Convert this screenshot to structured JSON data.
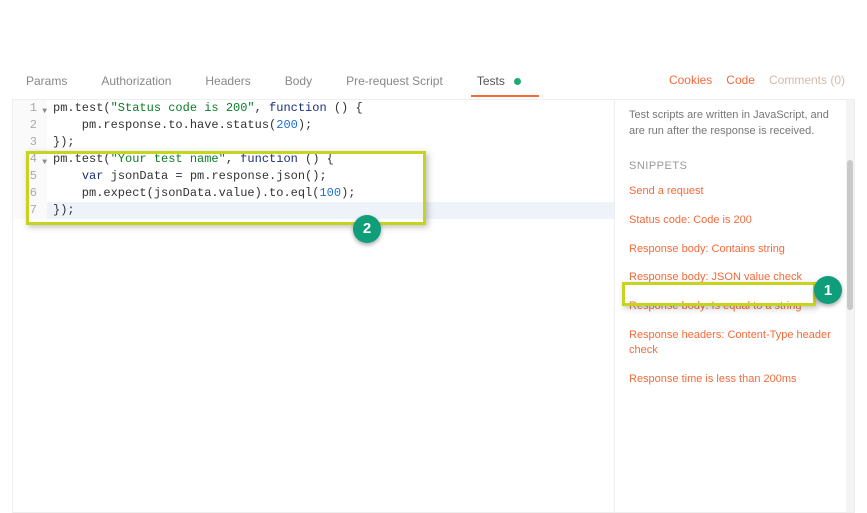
{
  "tabs": {
    "items": [
      "Params",
      "Authorization",
      "Headers",
      "Body",
      "Pre-request Script",
      "Tests"
    ],
    "active_index": 5
  },
  "links": {
    "cookies": "Cookies",
    "code": "Code",
    "comments": "Comments (0)"
  },
  "code": {
    "lines": [
      {
        "n": "1",
        "fold": "▼",
        "plain": "pm.test(",
        "str": "\"Status code is 200\"",
        "mid": ", ",
        "kw": "function",
        "tail": " () {"
      },
      {
        "n": "2",
        "plain": "    pm.response.to.have.status(",
        "num": "200",
        "tail": ");"
      },
      {
        "n": "3",
        "plain": "});"
      },
      {
        "n": "4",
        "fold": "▼",
        "plain": "pm.test(",
        "str": "\"Your test name\"",
        "mid": ", ",
        "kw": "function",
        "tail": " () {"
      },
      {
        "n": "5",
        "pre": "    ",
        "kw": "var",
        "plain": " jsonData = pm.response.json();"
      },
      {
        "n": "6",
        "plain": "    pm.expect(jsonData.value).to.eql(",
        "num": "100",
        "tail": ");"
      },
      {
        "n": "7",
        "plain": "});",
        "cursor": true
      }
    ]
  },
  "sidebar": {
    "desc": "Test scripts are written in JavaScript, and are run after the response is received.",
    "snippets_title": "SNIPPETS",
    "snippets": [
      "Send a request",
      "Status code: Code is 200",
      "Response body: Contains string",
      "Response body: JSON value check",
      "Response body: Is equal to a string",
      "Response headers: Content-Type header check",
      "Response time is less than 200ms"
    ]
  },
  "callouts": {
    "one": "1",
    "two": "2"
  }
}
